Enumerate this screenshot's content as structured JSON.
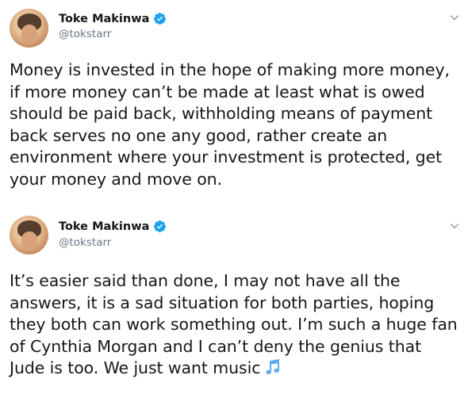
{
  "tweets": [
    {
      "author": {
        "display_name": "Toke Makinwa",
        "handle": "@tokstarr",
        "verified": true
      },
      "lines": [
        "Money is invested in the hope of making more money,",
        "if more money can’t be made at least what is owed",
        "should be paid back, withholding means of payment",
        "back serves no one any good, rather create an",
        "environment where your investment is protected, get",
        "your money and move on."
      ]
    },
    {
      "author": {
        "display_name": "Toke Makinwa",
        "handle": "@tokstarr",
        "verified": true
      },
      "lines": [
        "It’s easier said than done, I may not have all the",
        "answers, it is a sad situation for both parties, hoping",
        "they both can work something out. I’m such a huge fan",
        "of Cynthia Morgan and I can’t deny the genius that",
        "Jude is too. We just want music"
      ],
      "trailing_emoji": "music-notes"
    }
  ],
  "colors": {
    "verified_blue": "#1da1f2",
    "text": "#14171a",
    "secondary": "#657786",
    "emoji_blue": "#5dadec"
  }
}
